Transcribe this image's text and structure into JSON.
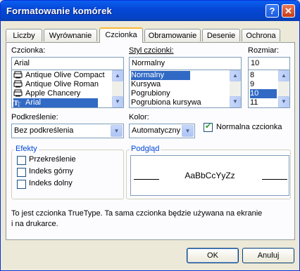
{
  "window": {
    "title": "Formatowanie komórek",
    "help_glyph": "?",
    "close_glyph": "✕"
  },
  "tabs": [
    {
      "label": "Liczby",
      "active": false
    },
    {
      "label": "Wyrównanie",
      "active": false
    },
    {
      "label": "Czcionka",
      "active": true
    },
    {
      "label": "Obramowanie",
      "active": false
    },
    {
      "label": "Desenie",
      "active": false
    },
    {
      "label": "Ochrona",
      "active": false
    }
  ],
  "font": {
    "label": "Czcionka:",
    "value": "Arial",
    "list": [
      "Antique Olive Compact",
      "Antique Olive Roman",
      "Apple Chancery",
      "Arial"
    ],
    "selected_index": 3
  },
  "style": {
    "label": "Styl czcionki:",
    "value": "Normalny",
    "list": [
      "Normalny",
      "Kursywa",
      "Pogrubiony",
      "Pogrubiona kursywa"
    ],
    "selected_index": 0
  },
  "size": {
    "label": "Rozmiar:",
    "value": "10",
    "list": [
      "8",
      "9",
      "10",
      "11"
    ],
    "selected_index": 2
  },
  "underline": {
    "label": "Podkreślenie:",
    "value": "Bez podkreślenia"
  },
  "color": {
    "label": "Kolor:",
    "value": "Automatyczny"
  },
  "normal_font": {
    "label": "Normalna czcionka",
    "checked": true
  },
  "effects": {
    "title": "Efekty",
    "items": [
      {
        "label": "Przekreślenie",
        "checked": false
      },
      {
        "label": "Indeks górny",
        "checked": false
      },
      {
        "label": "Indeks dolny",
        "checked": false
      }
    ]
  },
  "preview": {
    "title": "Podgląd",
    "sample": "AaBbCcYyZz"
  },
  "info": {
    "line1": "To jest czcionka TrueType. Ta sama czcionka będzie używana na ekranie",
    "line2": "i na drukarce."
  },
  "buttons": {
    "ok": "OK",
    "cancel": "Anuluj"
  },
  "colors": {
    "accent": "#316ac5",
    "titlebar": "#0647d6",
    "group_title": "#0046d5"
  }
}
